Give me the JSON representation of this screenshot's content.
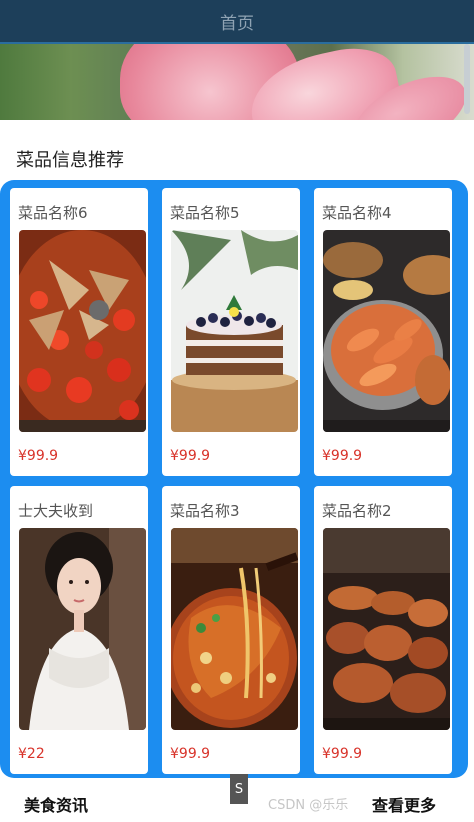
{
  "header": {
    "title": "首页"
  },
  "section": {
    "title": "菜品信息推荐"
  },
  "dishes": [
    {
      "name": "菜品名称6",
      "price": "¥99.9",
      "icon": "spicy-chicken-dish"
    },
    {
      "name": "菜品名称5",
      "price": "¥99.9",
      "icon": "cake"
    },
    {
      "name": "菜品名称4",
      "price": "¥99.9",
      "icon": "seafood-platter"
    },
    {
      "name": "士大夫收到",
      "price": "¥22",
      "icon": "portrait-woman"
    },
    {
      "name": "菜品名称3",
      "price": "¥99.9",
      "icon": "noodle-pot"
    },
    {
      "name": "菜品名称2",
      "price": "¥99.9",
      "icon": "grilled-meat"
    }
  ],
  "footer": {
    "news_label": "美食资讯",
    "more_label": "查看更多",
    "side_tab": "S",
    "watermark": "CSDN @乐乐"
  },
  "colors": {
    "header_bg": "#1d3f5a",
    "grid_bg": "#1c8df0",
    "price": "#d8332a"
  }
}
